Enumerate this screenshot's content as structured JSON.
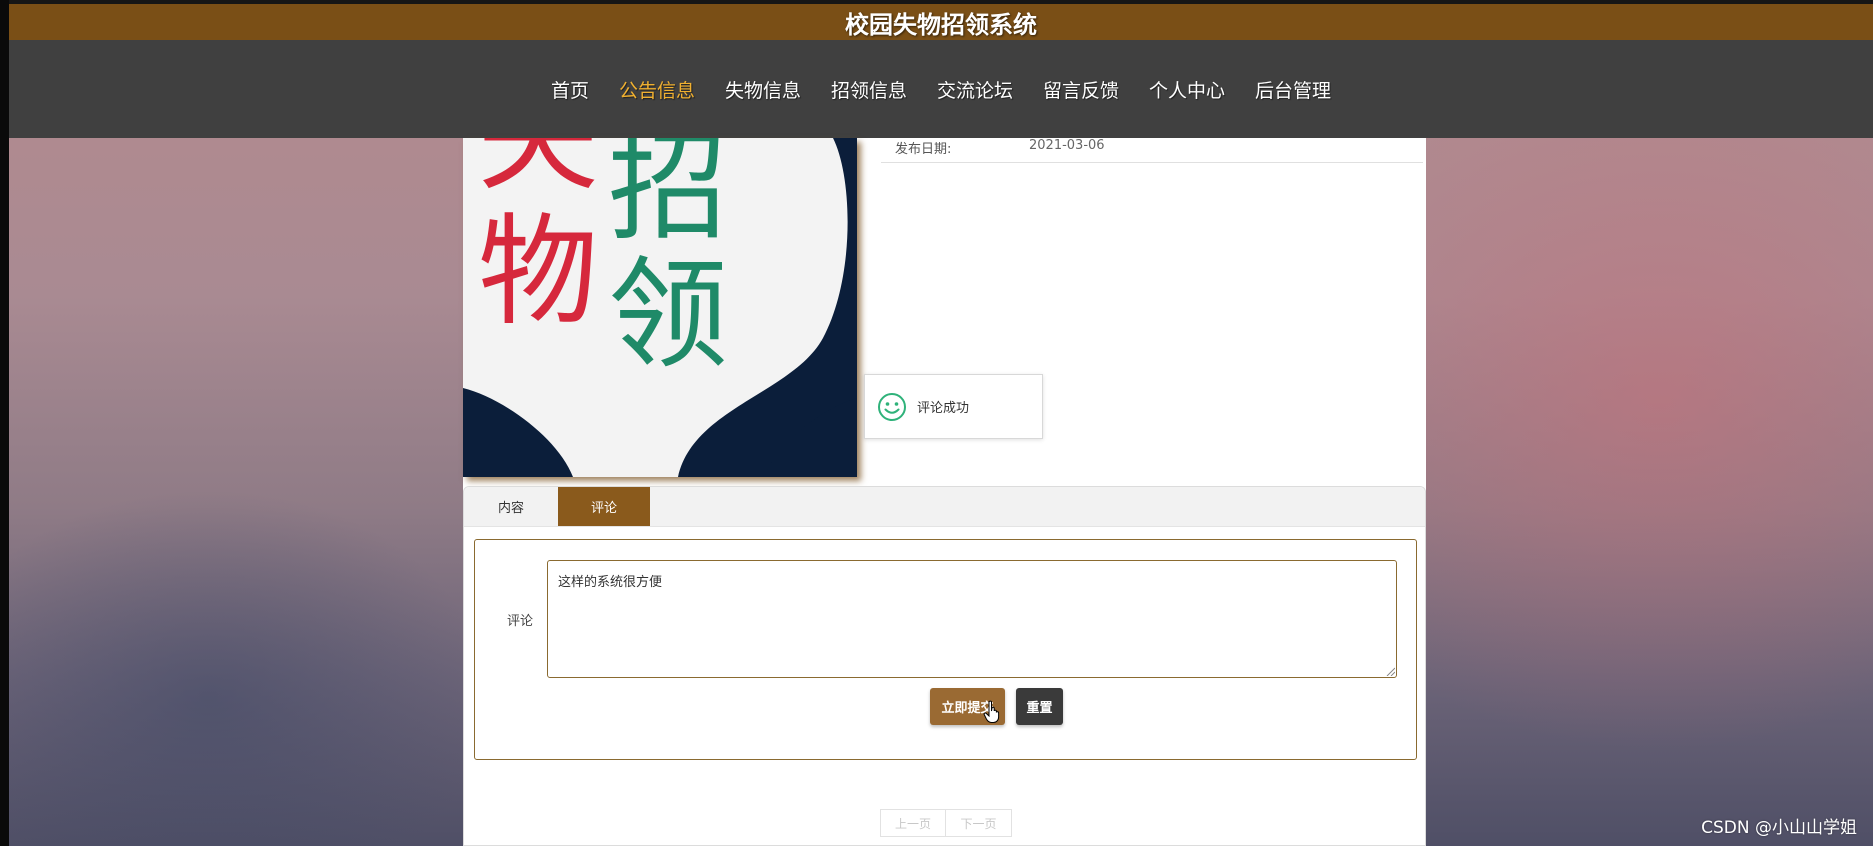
{
  "header": {
    "site_title": "校园失物招领系统"
  },
  "nav": {
    "items": [
      {
        "label": "首页",
        "active": false
      },
      {
        "label": "公告信息",
        "active": true
      },
      {
        "label": "失物信息",
        "active": false
      },
      {
        "label": "招领信息",
        "active": false
      },
      {
        "label": "交流论坛",
        "active": false
      },
      {
        "label": "留言反馈",
        "active": false
      },
      {
        "label": "个人中心",
        "active": false
      },
      {
        "label": "后台管理",
        "active": false
      }
    ],
    "active_color": "#f0b030"
  },
  "poster": {
    "chars_red": [
      "失",
      "物"
    ],
    "chars_green": [
      "招",
      "领"
    ]
  },
  "detail": {
    "publish_date_label": "发布日期:",
    "publish_date_value": "2021-03-06"
  },
  "toast": {
    "icon": "smile-icon",
    "message": "评论成功"
  },
  "tabs": {
    "content_label": "内容",
    "comment_label": "评论",
    "active": "comment"
  },
  "comment_form": {
    "label": "评论",
    "value": "这样的系统很方便",
    "submit_label": "立即提交",
    "reset_label": "重置"
  },
  "pager": {
    "prev_label": "上一页",
    "next_label": "下一页"
  },
  "watermark": "CSDN @小山山学姐",
  "colors": {
    "brand_brown": "#7a4f16",
    "nav_bg": "#404040",
    "submit_bg": "#9a6a33",
    "reset_bg": "#3a3a3a"
  }
}
